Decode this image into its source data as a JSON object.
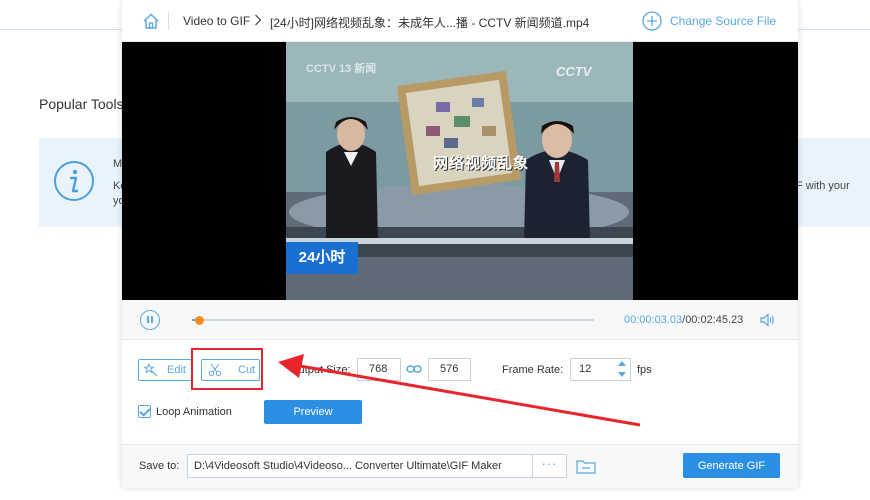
{
  "background": {
    "section_title": "Popular Tools",
    "info_line1": "M",
    "info_line2": "Ke",
    "info_line3": "yo",
    "info_right": "F with your"
  },
  "header": {
    "breadcrumb_root": "Video to GIF",
    "file_name": "[24小时]网络视频乱象：未成年人...播 - CCTV 新闻频道.mp4",
    "change_source_label": "Change Source File"
  },
  "video": {
    "channel_logo_left": "CCTV 13 新闻",
    "channel_logo_right": "CCTV",
    "banner_text": "网络视频乱象",
    "ticker_text": "24小时"
  },
  "playback": {
    "current_time": "00:00:03.03",
    "separator": "/",
    "total_time": "00:02:45.23",
    "progress": 0.0184
  },
  "tools": {
    "edit_label": "Edit",
    "cut_label": "Cut",
    "output_size_label": "Output Size:",
    "width_value": "768",
    "height_value": "576",
    "frame_rate_label": "Frame Rate:",
    "frame_rate_value": "12",
    "fps_unit": "fps",
    "loop_label": "Loop Animation",
    "loop_checked": true,
    "preview_label": "Preview"
  },
  "save": {
    "label": "Save to:",
    "path": "D:\\4Videosoft Studio\\4Videoso... Converter Ultimate\\GIF Maker",
    "more_label": "···",
    "generate_label": "Generate GIF"
  },
  "colors": {
    "accent": "#2b8fe3",
    "link": "#5aa8e0",
    "thumb": "#ff8a1c",
    "annotation": "#e8252c"
  }
}
